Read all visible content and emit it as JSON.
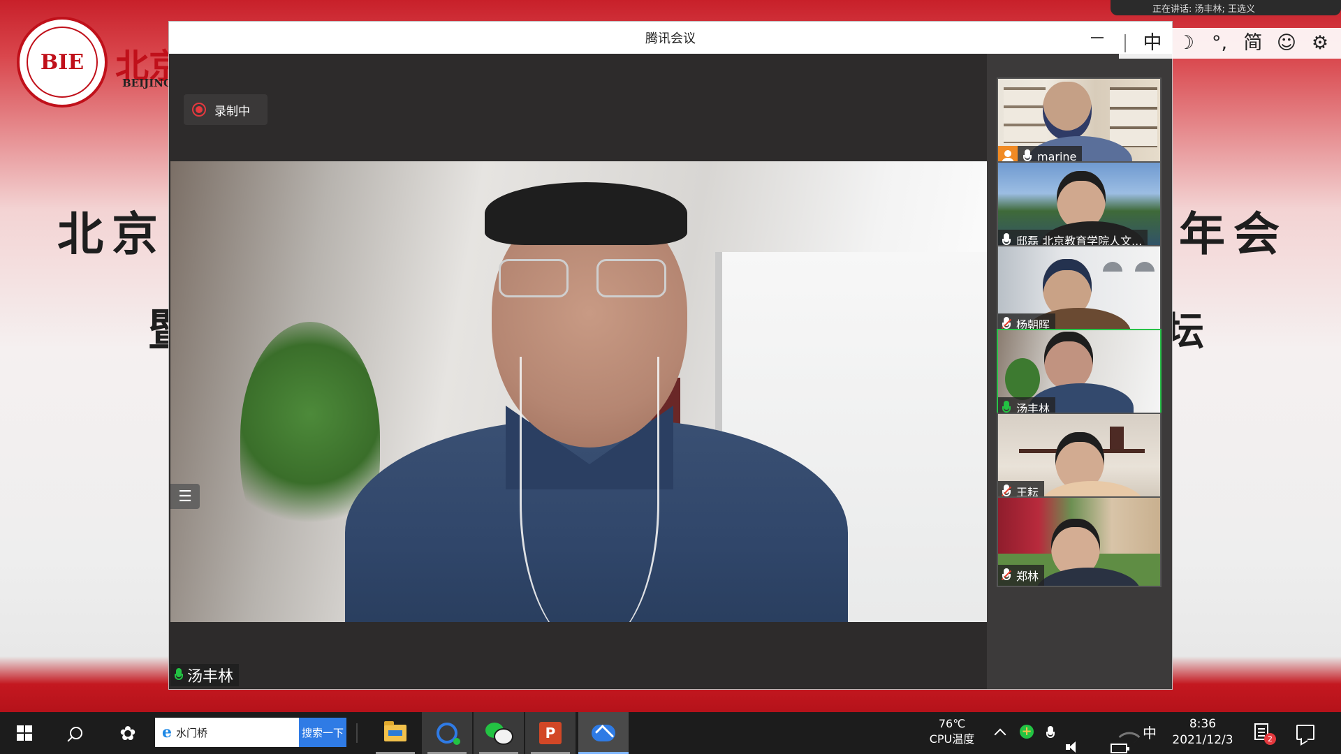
{
  "background": {
    "brand_cn": "北京",
    "brand_en": "BEIJING",
    "logo_text": "BIE",
    "title_left": "北京",
    "title_right": "年会",
    "sub_left": "暨",
    "sub_right": "坛"
  },
  "notification": {
    "text": "正在讲话: 汤丰林; 王选义"
  },
  "ime": {
    "mode": "中",
    "moon": "☽",
    "punct": "°,",
    "script": "简",
    "emoji": "☺",
    "settings": "⚙"
  },
  "window": {
    "title": "腾讯会议"
  },
  "recording": {
    "label": "录制中",
    "color": "#e5393e"
  },
  "main_speaker": {
    "name": "汤丰林"
  },
  "participants": [
    {
      "name": "marine",
      "mic": "on",
      "host": true
    },
    {
      "name": "邸磊 北京教育学院人文...",
      "mic": "on"
    },
    {
      "name": "杨朝晖",
      "mic": "muted"
    },
    {
      "name": "汤丰林",
      "mic": "speaking",
      "active": true
    },
    {
      "name": "王耘",
      "mic": "muted"
    },
    {
      "name": "郑林",
      "mic": "muted"
    }
  ],
  "taskbar": {
    "search_text": "水门桥",
    "search_button": "搜索一下",
    "temperature": "76℃",
    "temperature_label": "CPU温度",
    "ime_indicator": "中",
    "time": "8:36",
    "date": "2021/12/3",
    "notification_count": "2"
  },
  "colors": {
    "accent": "#2f7be5",
    "active_border": "#29c34a",
    "brand_red": "#c0101a"
  }
}
